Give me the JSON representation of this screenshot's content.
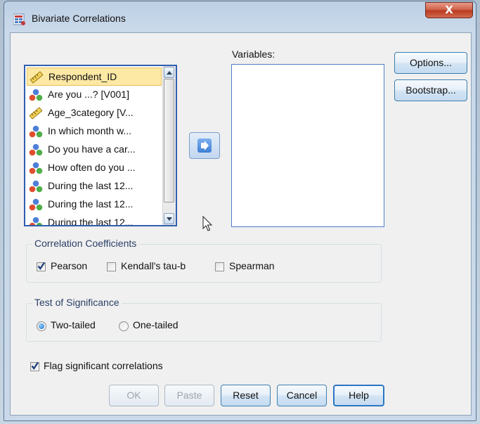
{
  "window": {
    "title": "Bivariate Correlations",
    "close_label": "X"
  },
  "variable_list": {
    "items": [
      {
        "label": "Respondent_ID",
        "icon": "ruler-scale-icon",
        "selected": true
      },
      {
        "label": "Are you ...? [V001]",
        "icon": "nominal-icon"
      },
      {
        "label": "Age_3category [V...",
        "icon": "ruler-scale-icon"
      },
      {
        "label": "In which month w...",
        "icon": "nominal-icon"
      },
      {
        "label": "Do you have a car...",
        "icon": "nominal-icon"
      },
      {
        "label": "How often do you ...",
        "icon": "nominal-icon"
      },
      {
        "label": "During the last 12...",
        "icon": "nominal-icon"
      },
      {
        "label": "During the last 12...",
        "icon": "nominal-icon"
      },
      {
        "label": "During the last 12...",
        "icon": "nominal-icon"
      }
    ]
  },
  "variables_box": {
    "label": "Variables:"
  },
  "side_buttons": {
    "options": "Options...",
    "bootstrap": "Bootstrap..."
  },
  "correlation": {
    "title": "Correlation Coefficients",
    "pearson": "Pearson",
    "kendall": "Kendall's tau-b",
    "spearman": "Spearman",
    "pearson_checked": true,
    "kendall_checked": false,
    "spearman_checked": false
  },
  "significance": {
    "title": "Test of Significance",
    "two_tailed": "Two-tailed",
    "one_tailed": "One-tailed",
    "selected": "two_tailed"
  },
  "flag": {
    "label": "Flag significant correlations",
    "checked": true
  },
  "footer_buttons": {
    "ok": "OK",
    "paste": "Paste",
    "reset": "Reset",
    "cancel": "Cancel",
    "help": "Help"
  },
  "colors": {
    "accent": "#2b76c5",
    "selected_item_bg": "#fde8a4",
    "group_title": "#2a3f66"
  }
}
